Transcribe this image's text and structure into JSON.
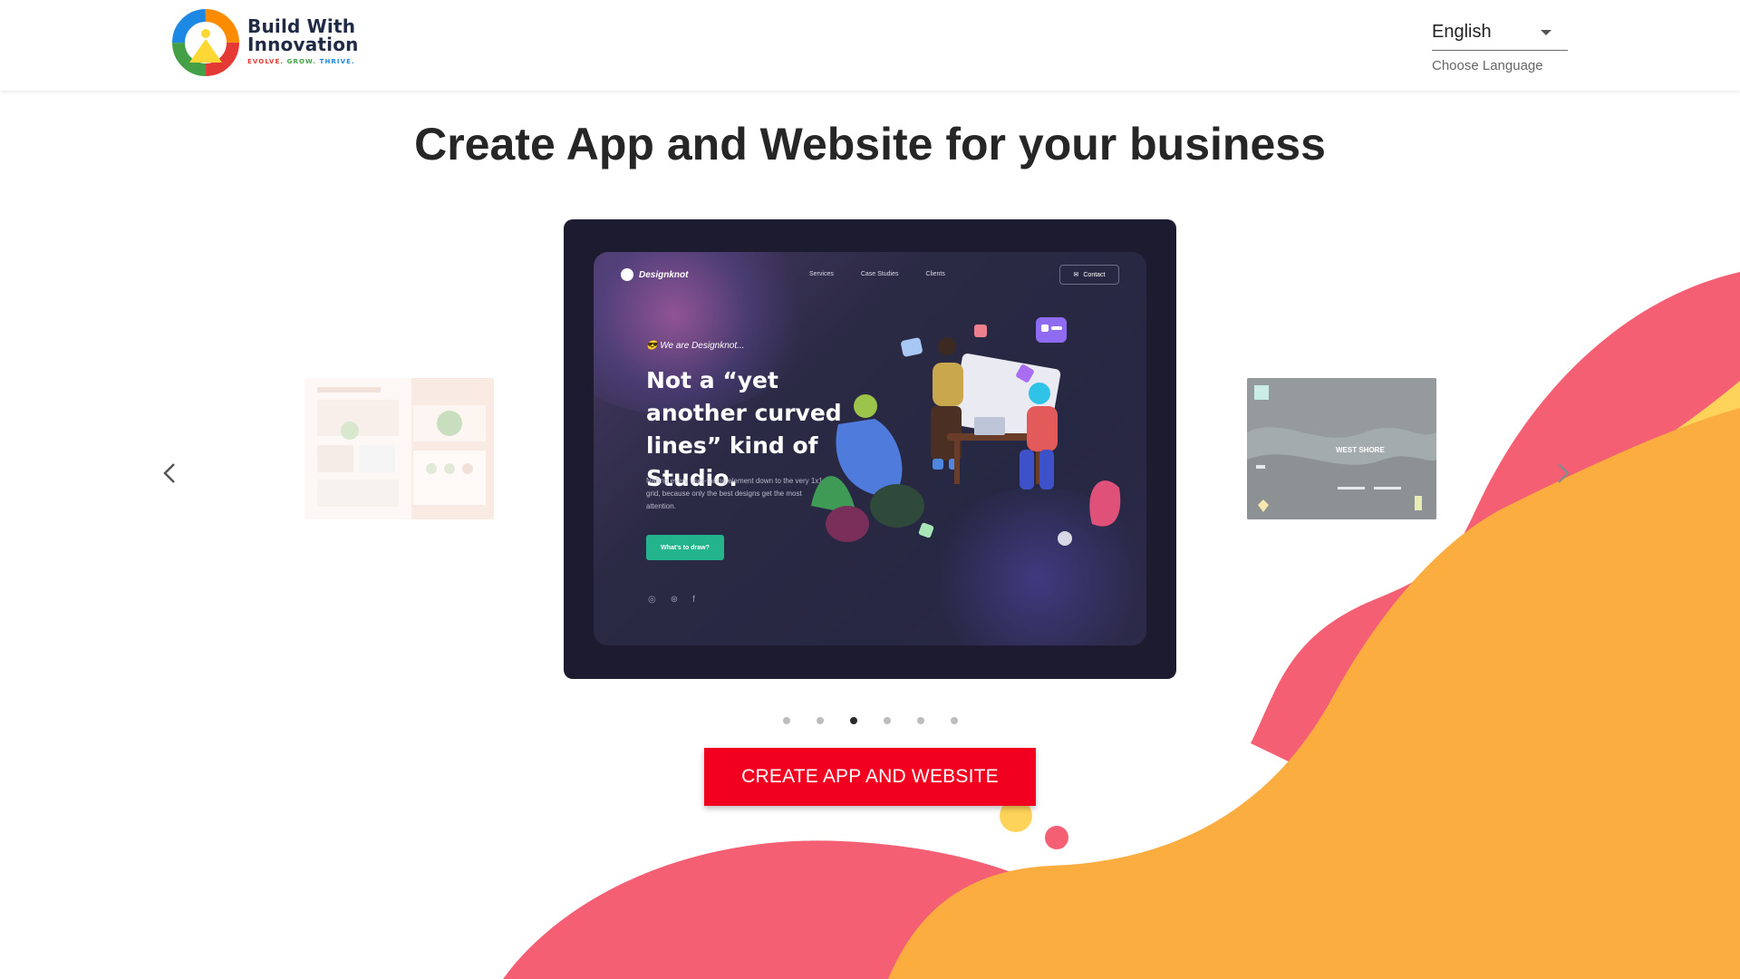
{
  "header": {
    "logo": {
      "line1": "Build With",
      "line2": "Innovation",
      "tagline_1": "EVOLVE.",
      "tagline_2": "GROW.",
      "tagline_3": "THRIVE."
    },
    "language": {
      "selected": "English",
      "helper": "Choose Language"
    }
  },
  "main": {
    "title": "Create App and Website for your business",
    "cta_label": "CREATE APP AND WEBSITE"
  },
  "carousel": {
    "active_index": 2,
    "dot_count": 6,
    "current_slide": {
      "brand": "Designknot",
      "nav": [
        "Services",
        "Case Studies",
        "Clients"
      ],
      "contact": "Contact",
      "kicker": "We are Designknot...",
      "headline": "Not a “yet another curved lines” kind of Studio.",
      "body": "Nailing every user-facing element down to the very 1x1 grid, because only the best designs get the most attention.",
      "cta": "What's to draw?"
    },
    "right_slide": {
      "caption": "WEST SHORE"
    }
  },
  "colors": {
    "cta_red": "#f2001f",
    "blob_pink": "#f45f74",
    "blob_orange": "#fbad3f",
    "blob_yellow": "#fdd35a",
    "slide_teal": "#23b38d"
  },
  "icons": {
    "prev": "chevron-left-icon",
    "next": "chevron-right-icon",
    "caret": "caret-down-icon"
  }
}
